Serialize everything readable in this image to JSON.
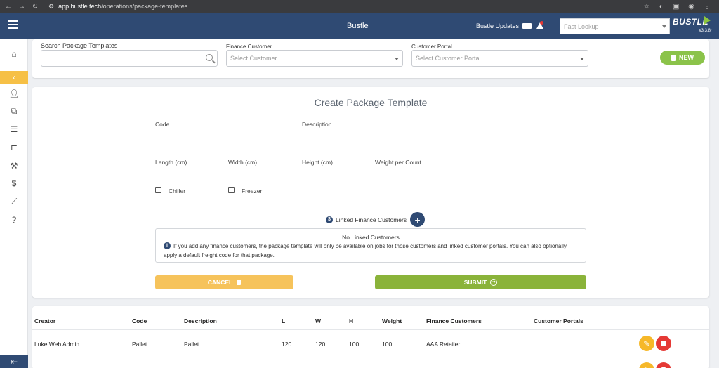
{
  "browser": {
    "url_host": "app.bustle.tech",
    "url_path": "/operations/package-templates"
  },
  "header": {
    "title": "Bustle",
    "updates_label": "Bustle Updates",
    "fast_lookup_placeholder": "Fast Lookup",
    "logo_text": "BUSTLE",
    "version": "v3.3.8r"
  },
  "search": {
    "search_label": "Search Package Templates",
    "finance_label": "Finance Customer",
    "finance_placeholder": "Select Customer",
    "portal_label": "Customer Portal",
    "portal_placeholder": "Select Customer Portal",
    "new_label": "NEW"
  },
  "form": {
    "title": "Create Package Template",
    "code_label": "Code",
    "description_label": "Description",
    "length_label": "Length (cm)",
    "width_label": "Width (cm)",
    "height_label": "Height (cm)",
    "weight_label": "Weight per Count",
    "chiller_label": "Chiller",
    "freezer_label": "Freezer",
    "linked_label": "Linked Finance Customers",
    "info_title": "No Linked Customers",
    "info_text": "If you add any finance customers, the package template will only be available on jobs for those customers and linked customer portals. You can also optionally apply a default freight code for that package.",
    "cancel_label": "CANCEL",
    "submit_label": "SUBMIT"
  },
  "table": {
    "headers": [
      "Creator",
      "Code",
      "Description",
      "L",
      "W",
      "H",
      "Weight",
      "Finance Customers",
      "Customer Portals"
    ],
    "rows": [
      {
        "creator": "Luke Web Admin",
        "code": "Pallet",
        "description": "Pallet",
        "l": "120",
        "w": "120",
        "h": "100",
        "weight": "100",
        "finance": "AAA Retailer",
        "portals": ""
      }
    ]
  },
  "colors": {
    "header_bg": "#2f4a73",
    "accent_green": "#8bc34a",
    "accent_yellow": "#f6c046",
    "danger_red": "#e53935"
  },
  "icons": {
    "menu": "hamburger-icon",
    "home": "home-icon",
    "collapse": "chevron-left-icon",
    "user": "person-icon",
    "packages": "boxes-icon",
    "list": "list-icon",
    "bed": "bed-icon",
    "tools": "wrench-icon",
    "money": "dollar-icon",
    "reports": "chart-line-icon",
    "help": "question-icon",
    "logout": "logout-icon"
  }
}
